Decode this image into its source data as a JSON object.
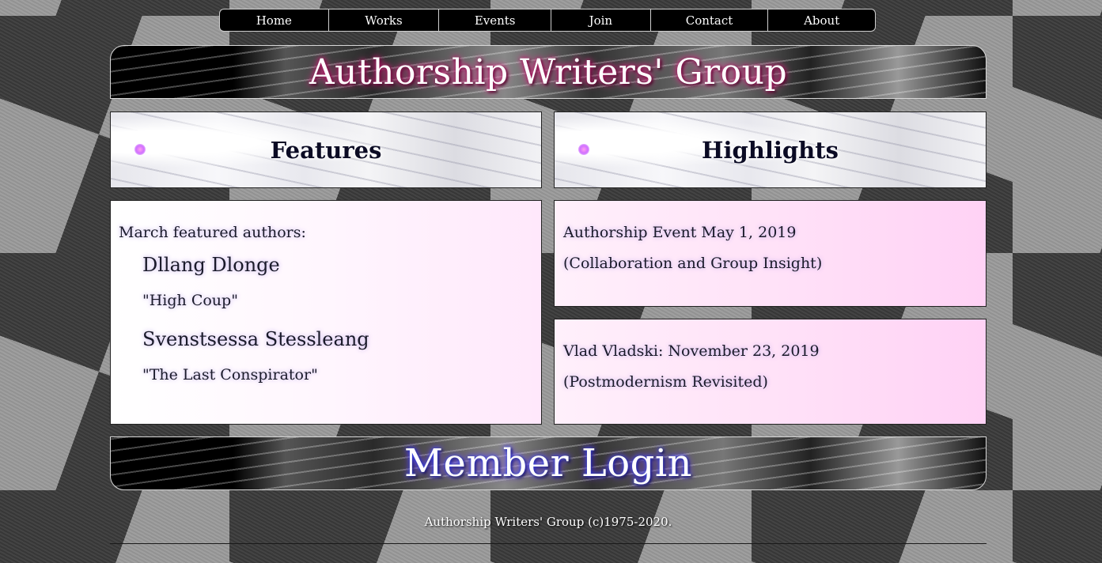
{
  "nav": {
    "items": [
      {
        "label": "Home"
      },
      {
        "label": "Works"
      },
      {
        "label": "Events"
      },
      {
        "label": "Join"
      },
      {
        "label": "Contact"
      },
      {
        "label": "About"
      }
    ]
  },
  "header": {
    "title": "Authorship Writers' Group"
  },
  "features": {
    "heading": "Features",
    "intro": "March featured authors:",
    "authors": [
      {
        "name": "Dllang Dlonge",
        "work": "\"High Coup\""
      },
      {
        "name": "Svenstsessa Stessleang",
        "work": "\"The Last Conspirator\""
      }
    ]
  },
  "highlights": {
    "heading": "Highlights",
    "items": [
      {
        "line1": "Authorship Event May 1, 2019",
        "line2": "(Collaboration and Group Insight)"
      },
      {
        "line1": "Vlad Vladski: November 23, 2019",
        "line2": "(Postmodernism Revisited)"
      }
    ]
  },
  "login": {
    "title": "Member Login"
  },
  "footer": {
    "copyright": "Authorship Writers' Group (c)1975-2020."
  },
  "colors": {
    "nav_bg": "#000000",
    "panel_pink": "#ffd8f8",
    "heading_text": "#0b0b24"
  }
}
